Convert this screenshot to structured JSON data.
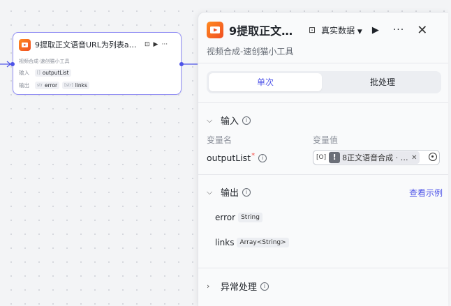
{
  "node": {
    "title": "9提取正文语音URL为列表au…",
    "subtitle": "视频合成-速创猫小工具",
    "input_label": "输入",
    "input_type_icon": "[]",
    "input_name": "outputList",
    "output_label": "输出",
    "outputs": [
      {
        "type_icon": "str",
        "name": "error"
      },
      {
        "type_icon": "[str]",
        "name": "links"
      }
    ]
  },
  "panel": {
    "title": "9提取正文…",
    "subtitle": "视频合成-速创猫小工具",
    "data_mode": "真实数据",
    "tabs": [
      "单次",
      "批处理"
    ],
    "input_section": "输入",
    "col_name": "变量名",
    "col_value": "变量值",
    "var_name": "outputList",
    "var_required_mark": "*",
    "var_value_type": "[O]",
    "var_value_text": "8正文语音合成 · o···",
    "output_section": "输出",
    "view_example": "查看示例",
    "outputs": [
      {
        "name": "error",
        "type": "String"
      },
      {
        "name": "links",
        "type": "Array<String>"
      }
    ],
    "exception_section": "异常处理"
  },
  "colors": {
    "accent": "#4d53e8",
    "node_border": "#8f8cf4",
    "brand_orange": "#f04e23"
  }
}
